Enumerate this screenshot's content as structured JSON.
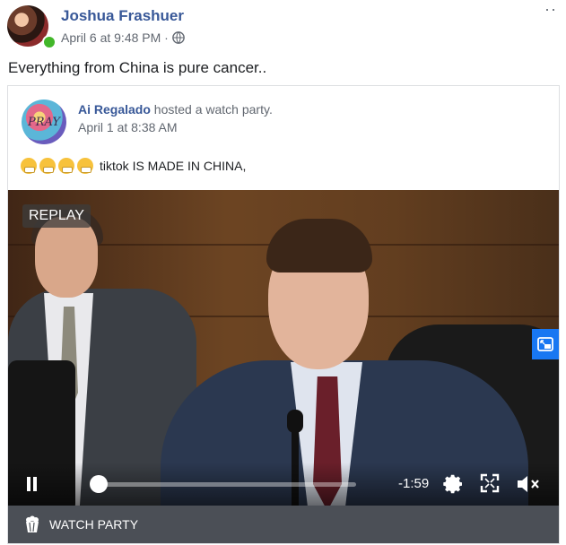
{
  "post": {
    "author": "Joshua Frashuer",
    "timestamp": "April 6 at 9:48 PM ·",
    "privacy_icon": "globe-icon",
    "text": "Everything from China is pure cancer..",
    "more_label": "··"
  },
  "shared": {
    "avatar_text": "PRAY",
    "author": "Ai Regalado",
    "action": " hosted a watch party.",
    "timestamp": "April 1 at 8:38 AM",
    "text": "tiktok IS MADE IN CHINA,"
  },
  "video": {
    "replay_label": "REPLAY",
    "time_remaining": "-1:59",
    "progress": 0.03,
    "muted": true
  },
  "watch_party": {
    "label": "WATCH PARTY"
  },
  "colors": {
    "link": "#385898",
    "online": "#42b72a",
    "pip_button": "#1877f2",
    "watch_bar": "#4b4f56"
  }
}
